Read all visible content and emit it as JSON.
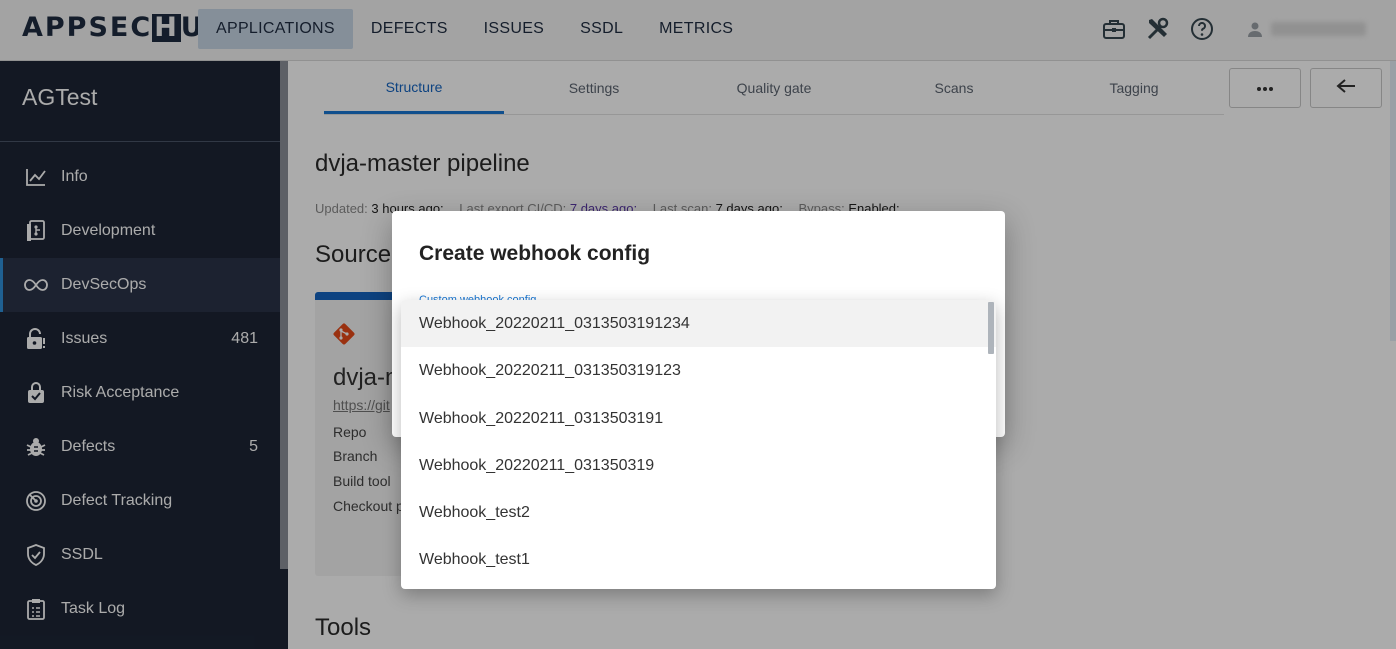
{
  "header": {
    "logo_left": "APPSEC",
    "logo_box": "H",
    "logo_right": "UB",
    "nav": [
      "APPLICATIONS",
      "DEFECTS",
      "ISSUES",
      "SSDL",
      "METRICS"
    ],
    "active_nav": "APPLICATIONS",
    "icons": [
      "briefcase-icon",
      "tools-icon",
      "help-icon",
      "user-icon"
    ]
  },
  "sidebar": {
    "app_name": "AGTest",
    "items": [
      {
        "label": "Info",
        "icon": "chart-line-icon",
        "count": ""
      },
      {
        "label": "Development",
        "icon": "repo-icon",
        "count": ""
      },
      {
        "label": "DevSecOps",
        "icon": "infinity-icon",
        "count": ""
      },
      {
        "label": "Issues",
        "icon": "lock-alert-icon",
        "count": "481"
      },
      {
        "label": "Risk Acceptance",
        "icon": "bag-check-icon",
        "count": ""
      },
      {
        "label": "Defects",
        "icon": "bug-icon",
        "count": "5"
      },
      {
        "label": "Defect Tracking",
        "icon": "radar-icon",
        "count": ""
      },
      {
        "label": "SSDL",
        "icon": "shield-check-icon",
        "count": ""
      },
      {
        "label": "Task Log",
        "icon": "clipboard-icon",
        "count": ""
      }
    ]
  },
  "tabs": [
    "Structure",
    "Settings",
    "Quality gate",
    "Scans",
    "Tagging"
  ],
  "main": {
    "title": "dvja-master pipeline",
    "meta": {
      "updated_label": "Updated:",
      "updated_value": "3 hours ago;",
      "export_label": "Last export CI/CD:",
      "export_value": "7 days ago;",
      "scan_label": "Last scan:",
      "scan_value": "7 days ago;",
      "bypass_label": "Bypass:",
      "bypass_value": "Enabled;"
    },
    "source_title": "Source",
    "tools_title": "Tools",
    "card": {
      "name": "dvja-m",
      "url": "https://git",
      "fields": [
        "Repo",
        "Branch",
        "Build tool",
        "Checkout p"
      ]
    }
  },
  "dialog": {
    "title": "Create webhook config",
    "field_label": "Custom webhook config",
    "options": [
      "Webhook_20220211_0313503191234",
      "Webhook_20220211_031350319123",
      "Webhook_20220211_0313503191",
      "Webhook_20220211_031350319",
      "Webhook_test2",
      "Webhook_test1"
    ],
    "highlighted_index": 0
  },
  "colors": {
    "sidebar_bg": "#1d2535",
    "accent": "#1976d2",
    "active_nav_bg": "#c7d5e5"
  }
}
